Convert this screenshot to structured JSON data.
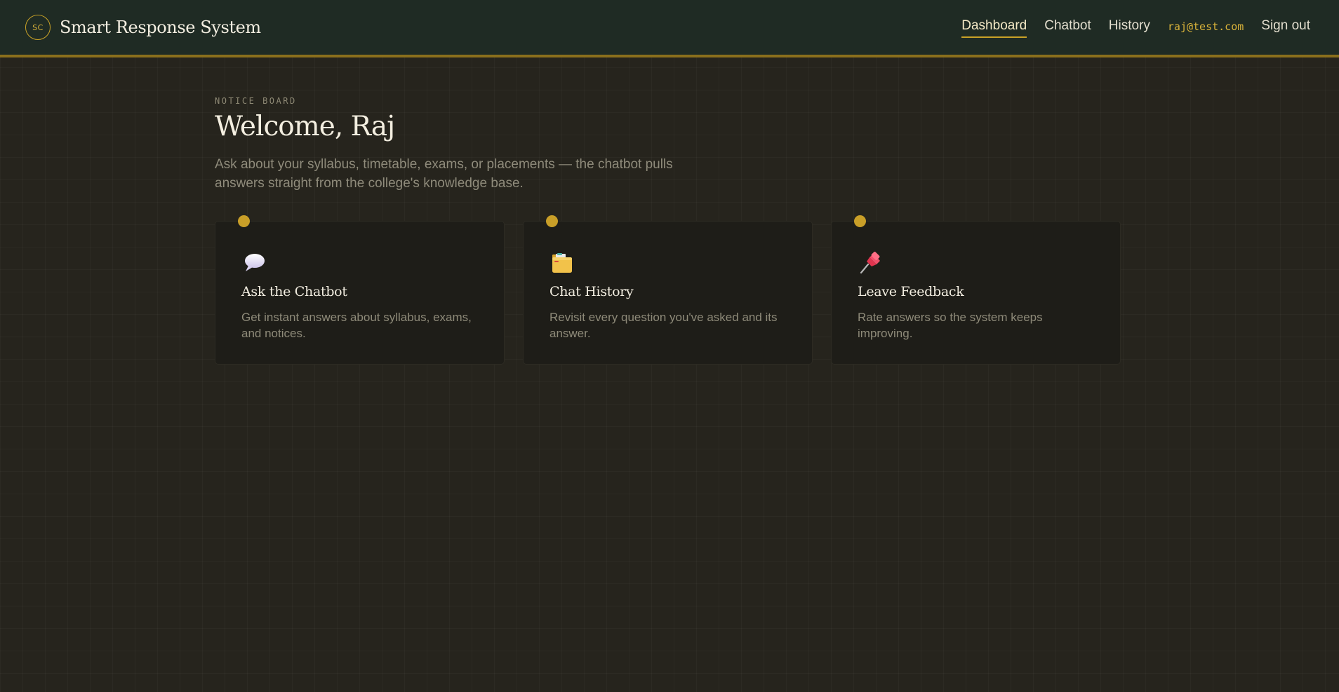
{
  "header": {
    "logo_text": "SC",
    "title": "Smart Response System",
    "nav": [
      {
        "label": "Dashboard",
        "active": true
      },
      {
        "label": "Chatbot",
        "active": false
      },
      {
        "label": "History",
        "active": false
      }
    ],
    "user_email": "raj@test.com",
    "signout_label": "Sign out"
  },
  "main": {
    "kicker": "NOTICE BOARD",
    "heading": "Welcome, Raj",
    "intro": "Ask about your syllabus, timetable, exams, or placements — the chatbot pulls answers straight from the college's knowledge base."
  },
  "cards": [
    {
      "icon": "speech-bubble-icon",
      "title": "Ask the Chatbot",
      "description": "Get instant answers about syllabus, exams, and notices."
    },
    {
      "icon": "folder-icon",
      "title": "Chat History",
      "description": "Revisit every question you've asked and its answer."
    },
    {
      "icon": "pushpin-icon",
      "title": "Leave Feedback",
      "description": "Rate answers so the system keeps improving."
    }
  ],
  "colors": {
    "accent": "#c9a227",
    "header_bg": "#1f2b24",
    "page_bg": "#26241d",
    "card_bg": "#1e1d18"
  }
}
